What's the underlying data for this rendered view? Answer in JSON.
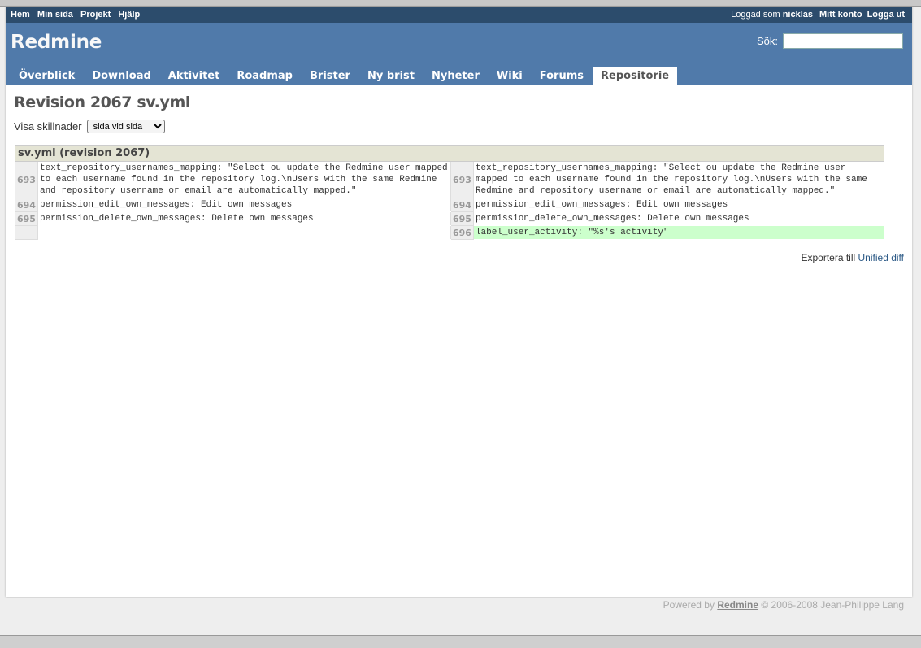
{
  "top_menu": {
    "left": [
      "Hem",
      "Min sida",
      "Projekt",
      "Hjälp"
    ],
    "logged_as_prefix": "Loggad som",
    "username": "nicklas",
    "account": "Mitt konto",
    "logout": "Logga ut"
  },
  "header": {
    "title": "Redmine",
    "search_label": "Sök:",
    "search_value": ""
  },
  "main_menu": {
    "tabs": [
      "Överblick",
      "Download",
      "Aktivitet",
      "Roadmap",
      "Brister",
      "Ny brist",
      "Nyheter",
      "Wiki",
      "Forums",
      "Repositorie"
    ],
    "selected": "Repositorie"
  },
  "content": {
    "title": "Revision 2067 sv.yml",
    "diff_label": "Visa skillnader",
    "diff_select": "sida vid sida",
    "filename": "sv.yml (revision 2067)",
    "rows": [
      {
        "left_num": "693",
        "left_code": "text_repository_usernames_mapping: \"Select ou update the Redmine user mapped to each username found in the repository log.\\nUsers with the same Redmine and repository username or email are automatically mapped.\"",
        "right_num": "693",
        "right_code": "text_repository_usernames_mapping: \"Select ou update the Redmine user mapped to each username found in the repository log.\\nUsers with the same Redmine and repository username or email are automatically mapped.\""
      },
      {
        "left_num": "694",
        "left_code": "permission_edit_own_messages: Edit own messages",
        "right_num": "694",
        "right_code": "permission_edit_own_messages: Edit own messages"
      },
      {
        "left_num": "695",
        "left_code": "permission_delete_own_messages: Delete own messages",
        "right_num": "695",
        "right_code": "permission_delete_own_messages: Delete own messages"
      },
      {
        "left_num": "",
        "left_code": "",
        "right_num": "696",
        "right_code": "label_user_activity: \"%s's activity\"",
        "added": true
      }
    ],
    "export_prefix": "Exportera till",
    "export_link": "Unified diff"
  },
  "footer": {
    "prefix": "Powered by",
    "link": "Redmine",
    "suffix": "© 2006-2008 Jean-Philippe Lang"
  }
}
